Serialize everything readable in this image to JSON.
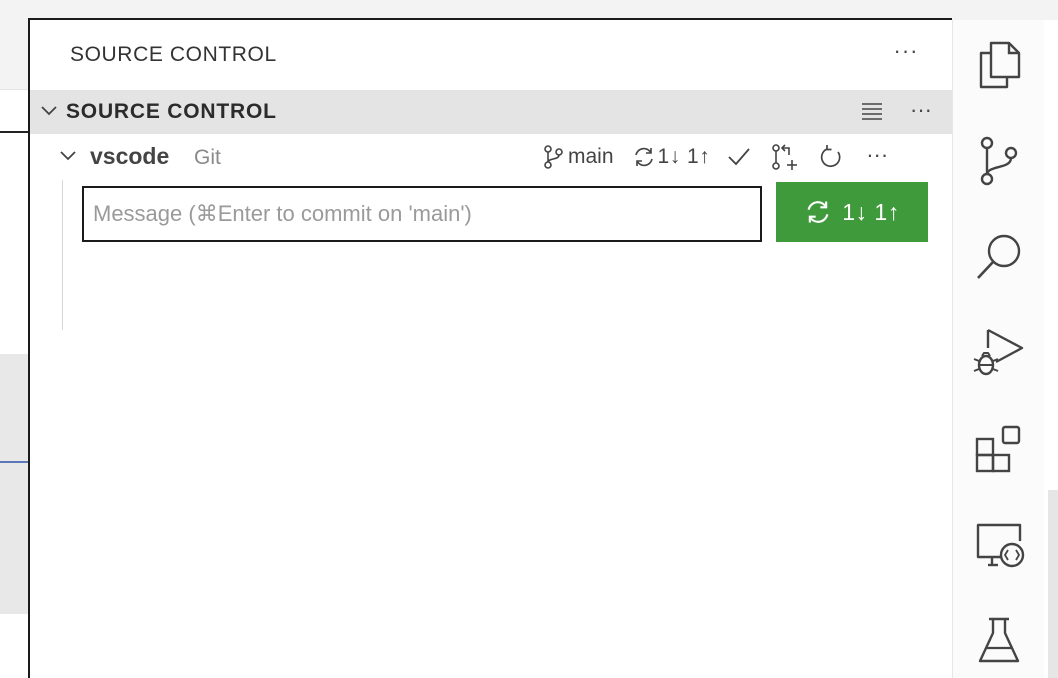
{
  "view": {
    "title": "SOURCE CONTROL",
    "more_label": "···"
  },
  "section": {
    "title": "SOURCE CONTROL",
    "more_label": "···"
  },
  "repository": {
    "name": "vscode",
    "provider": "Git",
    "branch": "main",
    "sync_status": "1↓ 1↑",
    "more_label": "···"
  },
  "commit": {
    "placeholder": "Message (⌘Enter to commit on 'main')",
    "value": ""
  },
  "sync_button": {
    "label": "1↓ 1↑",
    "color": "#3f9a3c"
  },
  "activity_bar": {
    "items": [
      {
        "icon": "explorer-icon",
        "active": false
      },
      {
        "icon": "source-control-icon",
        "active": true
      },
      {
        "icon": "search-icon",
        "active": false
      },
      {
        "icon": "run-debug-icon",
        "active": false
      },
      {
        "icon": "extensions-icon",
        "active": false
      },
      {
        "icon": "remote-explorer-icon",
        "active": false
      },
      {
        "icon": "testing-icon",
        "active": false
      }
    ],
    "active_indicator_color": "#f5826d"
  }
}
